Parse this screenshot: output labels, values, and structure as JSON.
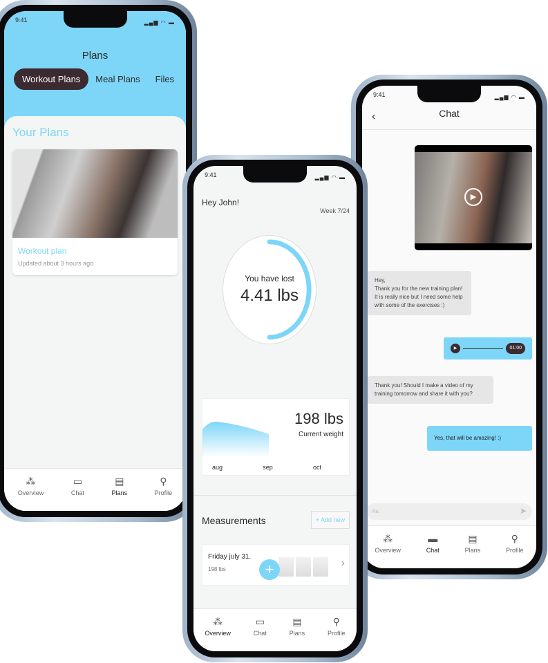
{
  "status": {
    "time": "9:41",
    "icons": "signal-wifi-battery"
  },
  "colors": {
    "accent": "#7dd6f8",
    "dark_pill": "#3b2a30"
  },
  "plans_screen": {
    "title": "Plans",
    "tabs": [
      "Workout Plans",
      "Meal Plans",
      "Files"
    ],
    "active_tab": "Workout Plans",
    "section": "Your Plans",
    "card": {
      "title": "Workout plan",
      "updated": "Updated about 3 hours ago"
    }
  },
  "overview_screen": {
    "greeting": "Hey John!",
    "week": "Week 7/24",
    "lost_label": "You have lost",
    "lost_value": "4.41 lbs",
    "progress_fraction": 0.5,
    "weight_value": "198 lbs",
    "weight_label": "Current weight",
    "months": [
      "aug",
      "sep",
      "oct"
    ],
    "measurements_title": "Measurements",
    "add_new": "+ Add new",
    "entry": {
      "date": "Friday july 31.",
      "weight": "198 lbs"
    },
    "fab": "+"
  },
  "chat_screen": {
    "title": "Chat",
    "messages": [
      {
        "type": "in",
        "text": "Hey,\nThank you for the new training plan! It is really nice but I need some help with some of the exercises :)"
      },
      {
        "type": "audio",
        "duration": "01:00"
      },
      {
        "type": "in",
        "text": "Thank you! Should I make a video of my training tomorrow and share it with you?"
      },
      {
        "type": "out",
        "text": "Yes, that will be amazing! :)"
      }
    ],
    "input_placeholder": "Aa"
  },
  "tabbar": [
    "Overview",
    "Chat",
    "Plans",
    "Profile"
  ]
}
